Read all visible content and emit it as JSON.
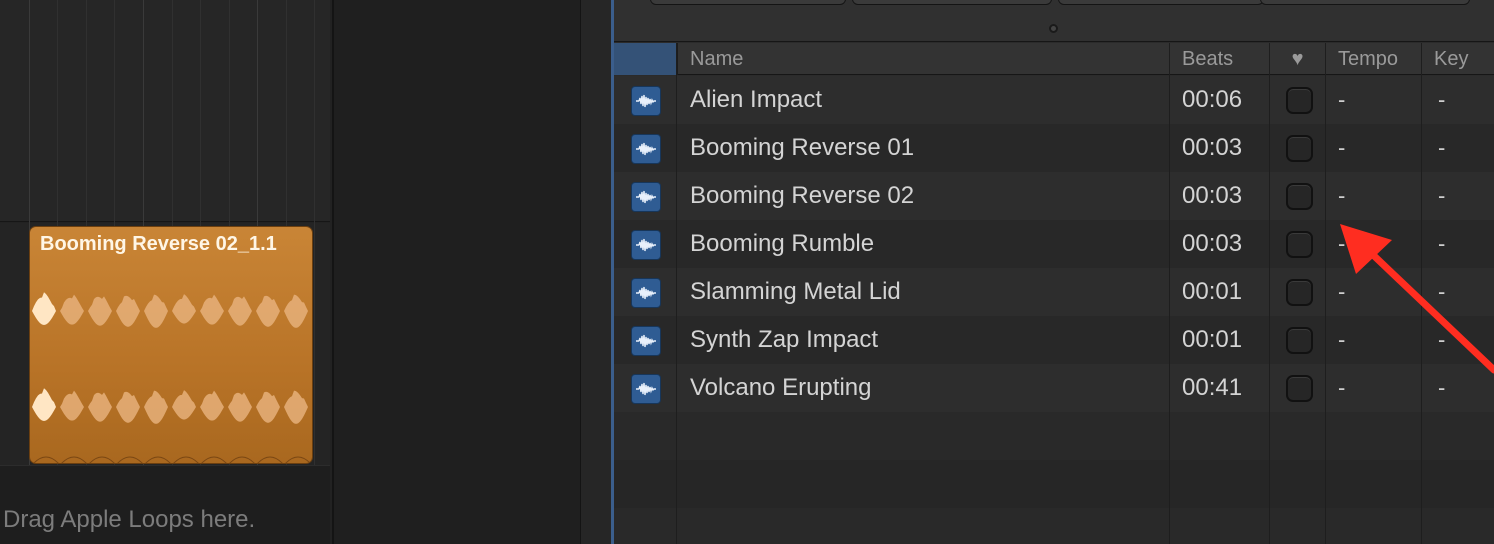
{
  "tracks": {
    "region": {
      "title": "Booming Reverse 02_1.1",
      "color": "#c98536"
    },
    "drop_hint": "Drag Apple Loops here."
  },
  "browser": {
    "columns": {
      "name": "Name",
      "beats": "Beats",
      "favorite_icon": "heart-icon",
      "favorite_glyph": "♥",
      "tempo": "Tempo",
      "key": "Key"
    },
    "rows": [
      {
        "icon": "audio-waveform-icon",
        "name": "Alien Impact",
        "beats": "00:06",
        "favorite": false,
        "tempo": "-",
        "key": "-"
      },
      {
        "icon": "audio-waveform-icon",
        "name": "Booming Reverse 01",
        "beats": "00:03",
        "favorite": false,
        "tempo": "-",
        "key": "-"
      },
      {
        "icon": "audio-waveform-icon",
        "name": "Booming Reverse 02",
        "beats": "00:03",
        "favorite": false,
        "tempo": "-",
        "key": "-"
      },
      {
        "icon": "audio-waveform-icon",
        "name": "Booming Rumble",
        "beats": "00:03",
        "favorite": false,
        "tempo": "-",
        "key": "-"
      },
      {
        "icon": "audio-waveform-icon",
        "name": "Slamming Metal Lid",
        "beats": "00:01",
        "favorite": false,
        "tempo": "-",
        "key": "-"
      },
      {
        "icon": "audio-waveform-icon",
        "name": "Synth Zap Impact",
        "beats": "00:01",
        "favorite": false,
        "tempo": "-",
        "key": "-"
      },
      {
        "icon": "audio-waveform-icon",
        "name": "Volcano Erupting",
        "beats": "00:41",
        "favorite": false,
        "tempo": "-",
        "key": "-"
      }
    ]
  },
  "annotation": {
    "arrow_color": "#ff2d20"
  }
}
